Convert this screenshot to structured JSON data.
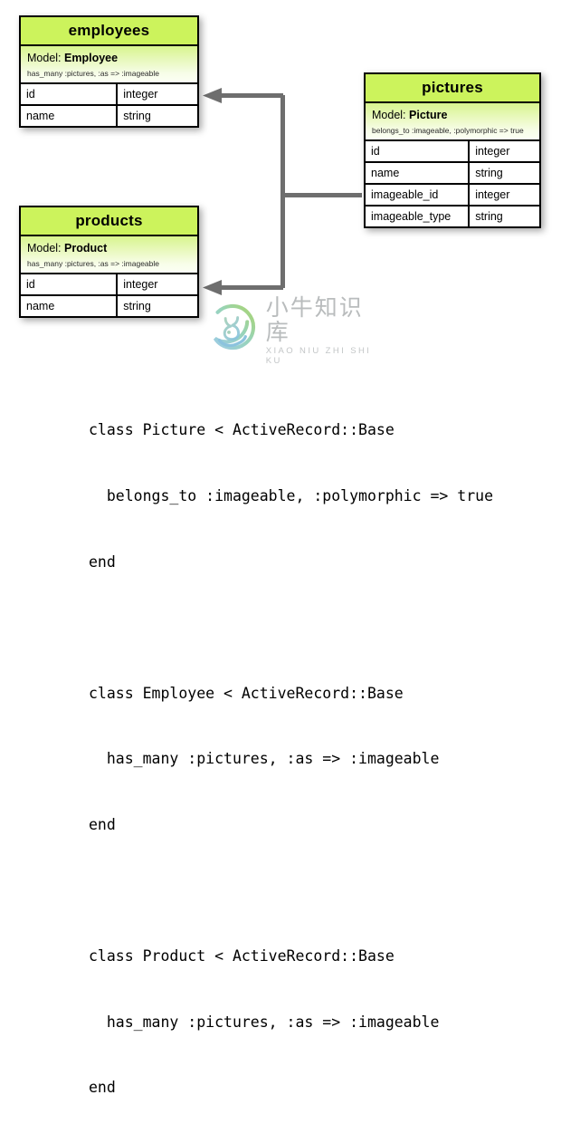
{
  "diagram": {
    "tables": [
      {
        "id": "employees",
        "title": "employees",
        "model_label": "Model:",
        "model_name": "Employee",
        "model_sub": "has_many :pictures, :as => :imageable",
        "columns": [
          {
            "name": "id",
            "type": "integer"
          },
          {
            "name": "name",
            "type": "string"
          }
        ]
      },
      {
        "id": "products",
        "title": "products",
        "model_label": "Model:",
        "model_name": "Product",
        "model_sub": "has_many :pictures, :as => :imageable",
        "columns": [
          {
            "name": "id",
            "type": "integer"
          },
          {
            "name": "name",
            "type": "string"
          }
        ]
      },
      {
        "id": "pictures",
        "title": "pictures",
        "model_label": "Model:",
        "model_name": "Picture",
        "model_sub": "belongs_to :imageable, :polymorphic => true",
        "columns": [
          {
            "name": "id",
            "type": "integer"
          },
          {
            "name": "name",
            "type": "string"
          },
          {
            "name": "imageable_id",
            "type": "integer"
          },
          {
            "name": "imageable_type",
            "type": "string"
          }
        ]
      }
    ],
    "colors": {
      "header_green": "#ccf35c",
      "model_gradient_top": "#d8f58e",
      "model_gradient_bottom": "#fcfff5",
      "border": "#000000",
      "connector_gray": "#6e6e6e",
      "row_background": "#ffffff"
    },
    "connector_label": "polymorphic association from pictures.imageable_id to employees and products"
  },
  "watermark": {
    "chinese": "小牛知识库",
    "pinyin": "XIAO NIU ZHI SHI KU",
    "ring_color_start": "#7fc9a0",
    "ring_color_end": "#8fc0dd",
    "text_color": "#b9bcbd"
  },
  "code": {
    "lines": [
      "class Picture < ActiveRecord::Base",
      "  belongs_to :imageable, :polymorphic => true",
      "end",
      "",
      "class Employee < ActiveRecord::Base",
      "  has_many :pictures, :as => :imageable",
      "end",
      "",
      "class Product < ActiveRecord::Base",
      "  has_many :pictures, :as => :imageable",
      "end"
    ]
  }
}
